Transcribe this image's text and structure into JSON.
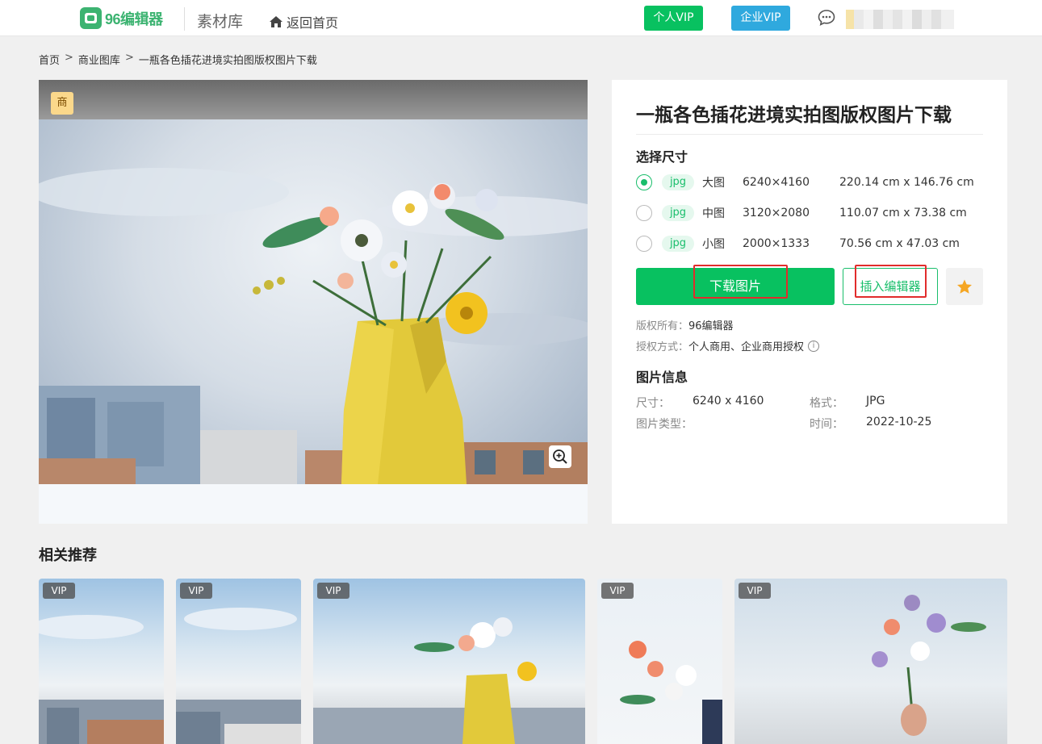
{
  "header": {
    "logo_text": "96编辑器",
    "site_name": "素材库",
    "back_home": "返回首页",
    "personal_vip": "个人VIP",
    "enterprise_vip": "企业VIP"
  },
  "breadcrumb": {
    "items": [
      "首页",
      "商业图库",
      "一瓶各色插花进境实拍图版权图片下载"
    ],
    "separator": ">"
  },
  "preview": {
    "badge": "商"
  },
  "detail": {
    "title": "一瓶各色插花进境实拍图版权图片下载",
    "choose_size_label": "选择尺寸",
    "sizes": [
      {
        "format": "jpg",
        "name": "大图",
        "pixels": "6240×4160",
        "cm": "220.14 cm x 146.76 cm",
        "selected": true
      },
      {
        "format": "jpg",
        "name": "中图",
        "pixels": "3120×2080",
        "cm": "110.07 cm x 73.38 cm",
        "selected": false
      },
      {
        "format": "jpg",
        "name": "小图",
        "pixels": "2000×1333",
        "cm": "70.56 cm x 47.03 cm",
        "selected": false
      }
    ],
    "download_label": "下载图片",
    "insert_label": "插入编辑器",
    "copyright_label": "版权所有：",
    "copyright_value": "96编辑器",
    "license_label": "授权方式：",
    "license_value": "个人商用、企业商用授权",
    "info_title": "图片信息",
    "info": {
      "size_label": "尺寸：",
      "size_value": "6240 x 4160",
      "format_label": "格式：",
      "format_value": "JPG",
      "type_label": "图片类型：",
      "type_value": "",
      "time_label": "时间：",
      "time_value": "2022-10-25"
    }
  },
  "related": {
    "title": "相关推荐",
    "items": [
      {
        "tag": "VIP"
      },
      {
        "tag": "VIP"
      },
      {
        "tag": "VIP"
      },
      {
        "tag": "VIP"
      },
      {
        "tag": "VIP"
      }
    ]
  },
  "colors": {
    "brand_green": "#08c160",
    "enterprise_blue": "#2fa9de",
    "highlight_red": "#e12c2c",
    "star_orange": "#f5a623"
  },
  "icons": {
    "home": "home-icon",
    "message": "message-icon",
    "zoom": "zoom-in-icon",
    "star": "star-icon",
    "info": "info-icon"
  }
}
